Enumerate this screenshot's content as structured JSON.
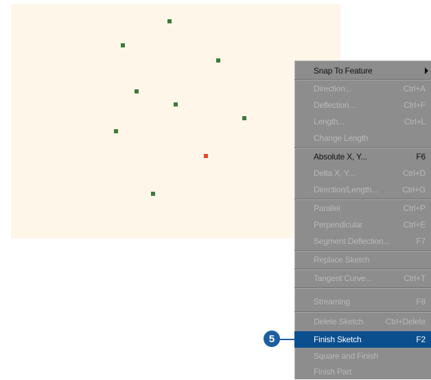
{
  "map": {
    "vertices": [
      "vertex",
      "vertex",
      "vertex",
      "vertex",
      "vertex",
      "vertex",
      "vertex",
      "vertex",
      "vertex"
    ],
    "selected_vertex_color": "#e8472b",
    "vertex_color": "#3f7a3a"
  },
  "menu": {
    "items": [
      {
        "label": "Snap To Feature",
        "shortcut": "",
        "enabled": true,
        "submenu": true
      },
      {
        "label": "Direction...",
        "shortcut": "Ctrl+A",
        "enabled": false
      },
      {
        "label": "Deflection...",
        "shortcut": "Ctrl+F",
        "enabled": false
      },
      {
        "label": "Length...",
        "shortcut": "Ctrl+L",
        "enabled": false
      },
      {
        "label": "Change Length",
        "shortcut": "",
        "enabled": false
      },
      {
        "label": "Absolute X, Y...",
        "shortcut": "F6",
        "enabled": true
      },
      {
        "label": "Delta X, Y...",
        "shortcut": "Ctrl+D",
        "enabled": false
      },
      {
        "label": "Direction/Length...",
        "shortcut": "Ctrl+G",
        "enabled": false
      },
      {
        "label": "Parallel",
        "shortcut": "Ctrl+P",
        "enabled": false
      },
      {
        "label": "Perpendicular",
        "shortcut": "Ctrl+E",
        "enabled": false
      },
      {
        "label": "Segment Deflection...",
        "shortcut": "F7",
        "enabled": false
      },
      {
        "label": "Replace Sketch",
        "shortcut": "",
        "enabled": false
      },
      {
        "label": "Tangent Curve...",
        "shortcut": "Ctrl+T",
        "enabled": false
      },
      {
        "label": "Streaming",
        "shortcut": "F8",
        "enabled": false
      },
      {
        "label": "Delete Sketch",
        "shortcut": "Ctrl+Delete",
        "enabled": false
      },
      {
        "label": "Finish Sketch",
        "shortcut": "F2",
        "enabled": true,
        "highlighted": true
      },
      {
        "label": "Square and Finish",
        "shortcut": "",
        "enabled": false
      },
      {
        "label": "Finish Part",
        "shortcut": "",
        "enabled": false
      }
    ]
  },
  "callout": {
    "number": "5"
  },
  "colors": {
    "menu_background": "#8d8d8d",
    "highlight": "#0b4f8f",
    "disabled_text": "#b8b8b8",
    "callout": "#1c5ea2"
  }
}
